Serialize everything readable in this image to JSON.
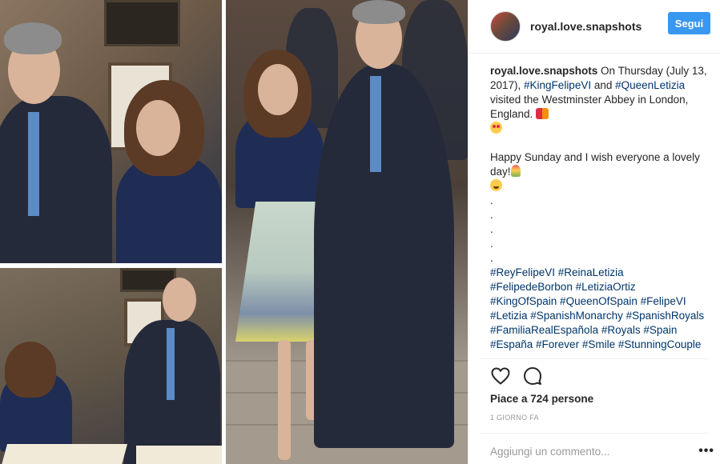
{
  "post": {
    "photo_alt": ""
  },
  "header": {
    "username": "royal.love.snapshots",
    "follow_label": "Segui"
  },
  "caption": {
    "username": "royal.love.snapshots",
    "part1": " On Thursday (July 13, 2017), ",
    "tag_felipe": "#KingFelipeVI",
    "part2": " and ",
    "tag_letizia": "#QueenLetizia",
    "part3": " visited the Westminster Abbey in London, England. ",
    "happy": "Happy Sunday and I wish everyone a lovely day!",
    "dot": "."
  },
  "hashtags": [
    "#ReyFelipeVI #ReinaLetizia",
    "#FelipedeBorbon #LetiziaOrtiz",
    "#KingOfSpain #QueenOfSpain #FelipeVI",
    "#Letizia #SpanishMonarchy #SpanishRoyals",
    "#FamiliaRealEspañola #Royals #Spain",
    "#España #Forever #Smile #StunningCouple"
  ],
  "icons": {
    "like": "heart-icon",
    "comment": "comment-bubble-icon",
    "more": "more-options-icon"
  },
  "likes": "Piace a 724 persone",
  "timestamp": "1 GIORNO FA",
  "comment_box": {
    "placeholder": "Aggiungi un commento..."
  },
  "more_label": "•••",
  "colors": {
    "follow_button": "#3897f0",
    "hashtag": "#003569",
    "muted": "#999999"
  }
}
